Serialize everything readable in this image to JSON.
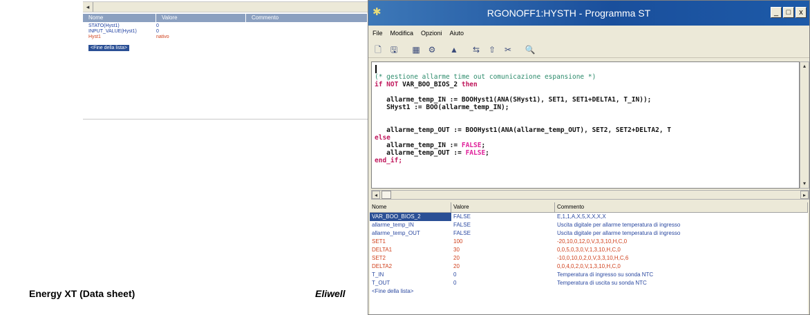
{
  "background_window": {
    "headers": [
      "Nome",
      "Valore",
      "Commento"
    ],
    "rows": [
      {
        "name": "STATO(Hyst1)",
        "value": "0",
        "color": "blue"
      },
      {
        "name": "INPUT_VALUE(Hyst1)",
        "value": "0",
        "color": "blue"
      },
      {
        "name": "Hyst1",
        "value": "nativo",
        "color": "red"
      }
    ],
    "end_marker": "<Fine della lista>"
  },
  "window": {
    "title": "RGONOFF1:HYSTH - Programma ST",
    "buttons": {
      "minimize": "_",
      "maximize": "□",
      "close": "x"
    },
    "menu": [
      "File",
      "Modifica",
      "Opzioni",
      "Aiuto"
    ],
    "toolbar_icons": [
      "new-icon",
      "save-icon",
      "compile-icon",
      "debug-icon",
      "find-icon",
      "cut-icon",
      "paste-icon",
      "tool-icon",
      "zoom-icon"
    ]
  },
  "code": {
    "line_comment": "(* gestione allarme time out comunicazione espansione *)",
    "line_if_kw1": "if ",
    "line_if_kw2": "NOT",
    "line_if_mid": " VAR_BOO_BIOS_2 ",
    "line_if_kw3": "then",
    "line_a1": "allarme_temp_IN := BOOHyst1(ANA(SHyst1), SET1, SET1+DELTA1, T_IN));",
    "line_a2": "SHyst1 := BOO(allarme_temp_IN);",
    "line_b1": "allarme_temp_OUT := BOOHyst1(ANA(allarme_temp_OUT), SET2, SET2+DELTA2, T",
    "line_else": "else",
    "line_c1_pre": "allarme_temp_IN := ",
    "line_c1_val": "FALSE",
    "line_c2_pre": "allarme_temp_OUT := ",
    "line_c2_val": "FALSE",
    "line_endif": "end_if;"
  },
  "variables": {
    "headers": [
      "Nome",
      "Valore",
      "Commento"
    ],
    "rows": [
      {
        "name": "VAR_BOO_BIOS_2",
        "value": "FALSE",
        "comment": "E,1,1,A,X,5,X,X,X,X",
        "color": "blue",
        "selected": true
      },
      {
        "name": "allarme_temp_IN",
        "value": "FALSE",
        "comment": "Uscita digitale per allarme temperatura di ingresso",
        "color": "blue"
      },
      {
        "name": "allarme_temp_OUT",
        "value": "FALSE",
        "comment": "Uscita digitale per allarme temperatura di ingresso",
        "color": "blue"
      },
      {
        "name": "SET1",
        "value": "100",
        "comment": "-20,10,0,12,0,V,3,3,10,H,C,0",
        "color": "red"
      },
      {
        "name": "DELTA1",
        "value": "30",
        "comment": "0,0,5,0,3,0,V,1,3,10,H,C,0",
        "color": "red"
      },
      {
        "name": "SET2",
        "value": "20",
        "comment": "-10,0,10,0,2,0,V,3,3,10,H,C,6",
        "color": "red"
      },
      {
        "name": "DELTA2",
        "value": "20",
        "comment": "0,0,4,0,2,0,V,1,3,10,H,C,0",
        "color": "red"
      },
      {
        "name": "T_IN",
        "value": "0",
        "comment": "Temperatura di ingresso su sonda NTC",
        "color": "blue"
      },
      {
        "name": "T_OUT",
        "value": "0",
        "comment": "Temperatura di uscita su sonda NTC",
        "color": "blue"
      }
    ],
    "end_marker": "<Fine della lista>"
  },
  "captions": {
    "left": "Energy XT (Data sheet)",
    "middle": "Eliwell"
  }
}
